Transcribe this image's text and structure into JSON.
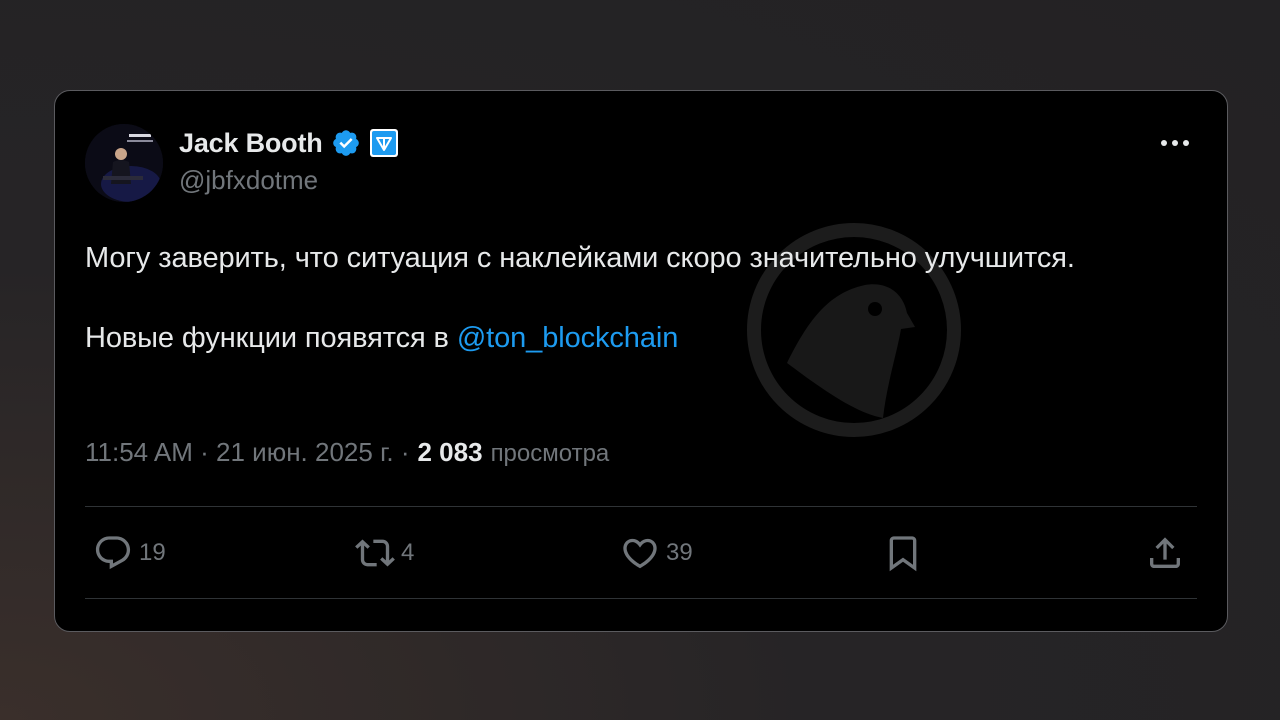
{
  "tweet": {
    "author": {
      "name": "Jack Booth",
      "handle": "@jbfxdotme"
    },
    "text": {
      "line1": "Могу заверить, что ситуация с наклейками скоро значительно улучшится.",
      "line2_prefix": "Новые функции появятся в ",
      "line2_mention": "@ton_blockchain"
    },
    "meta": {
      "time_date": "11:54 AM · 21 июн. 2025 г. ·",
      "views_count": "2 083",
      "views_label": "просмотра"
    },
    "actions": {
      "replies": "19",
      "reposts": "4",
      "likes": "39"
    }
  },
  "colors": {
    "card_bg": "#000000",
    "text_primary": "#e7e9ea",
    "text_secondary": "#71767b",
    "accent": "#1d9bf0"
  },
  "icons": {
    "verified": "verified-badge-icon",
    "affiliate": "ton-affiliate-badge-icon",
    "more": "more-horizontal-icon",
    "reply": "reply-bubble-icon",
    "repost": "repost-arrows-icon",
    "like": "heart-icon",
    "bookmark": "bookmark-icon",
    "share": "share-upload-icon",
    "watermark": "bird-in-circle-icon"
  }
}
